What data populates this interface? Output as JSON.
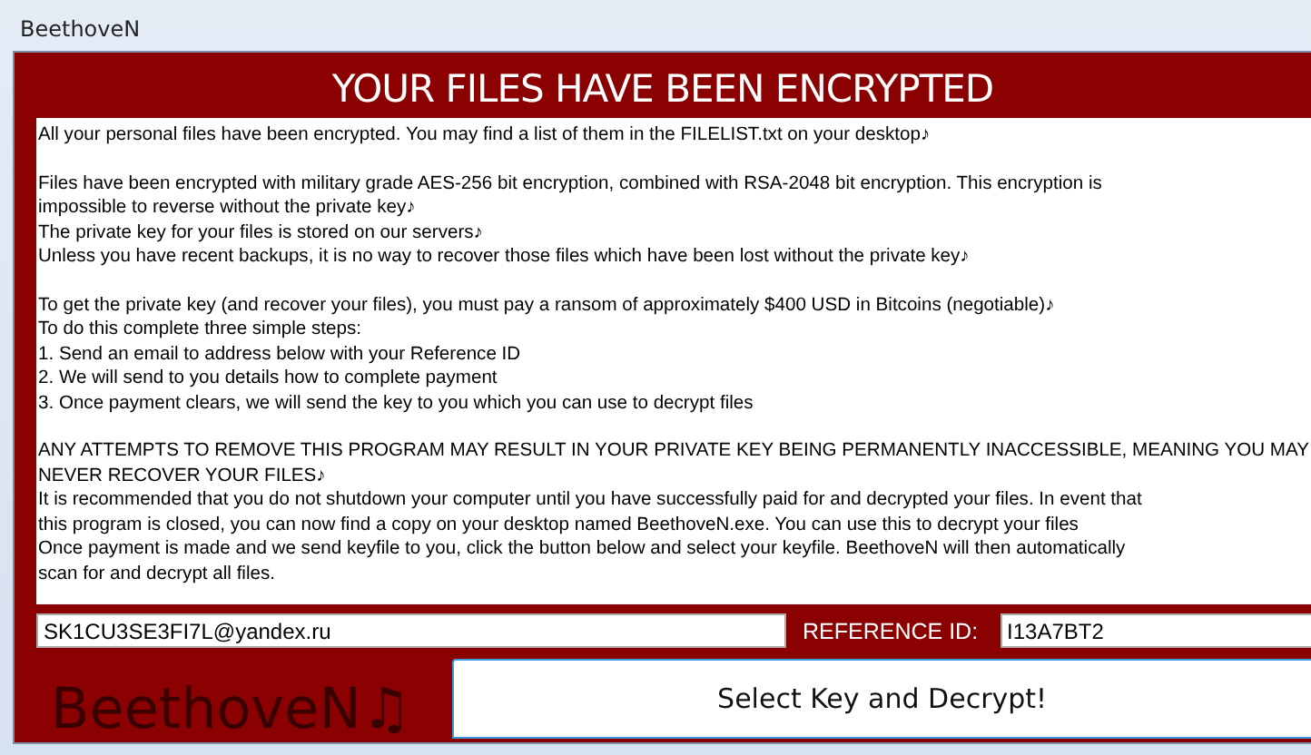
{
  "window": {
    "title": "BeethoveN"
  },
  "heading": "YOUR FILES HAVE BEEN ENCRYPTED",
  "paragraphs": [
    [
      "All your personal files have been encrypted. You may find a list of them in the FILELIST.txt on your desktop♪"
    ],
    [
      "Files have been encrypted with military grade AES-256 bit encryption, combined with RSA-2048 bit encryption. This encryption is",
      "impossible to reverse without the private key♪",
      "The private key for your files is stored on our servers♪",
      "Unless you have recent backups, it is no way to recover those files which have been lost without the private key♪"
    ],
    [
      "To get the private key (and recover your files), you must pay a ransom of approximately $400 USD in Bitcoins (negotiable)♪",
      "To do this complete three simple steps:",
      "1. Send an email to address below with your Reference ID",
      "2. We will send to you details how to complete payment",
      "3. Once payment clears, we will send the key to you which you can use to decrypt files"
    ],
    [
      "ANY ATTEMPTS TO REMOVE THIS PROGRAM MAY RESULT IN YOUR PRIVATE KEY BEING PERMANENTLY INACCESSIBLE, MEANING YOU MAY",
      "NEVER RECOVER YOUR FILES♪",
      "It is recommended that you do not shutdown your computer until you have successfully paid for and decrypted your files. In event that",
      "this program is closed, you can now find a copy on your desktop named BeethoveN.exe. You can use this to decrypt your files",
      "Once payment is made and we send keyfile to you, click the button below and select your keyfile. BeethoveN will then automatically",
      "scan for and decrypt all files."
    ]
  ],
  "email_field": {
    "value": "SK1CU3SE3FI7L@yandex.ru"
  },
  "reference_label": "REFERENCE ID:",
  "reference_field": {
    "value": "I13A7BT2"
  },
  "logo_text": "BeethoveN♫",
  "decrypt_button": "Select Key and Decrypt!"
}
